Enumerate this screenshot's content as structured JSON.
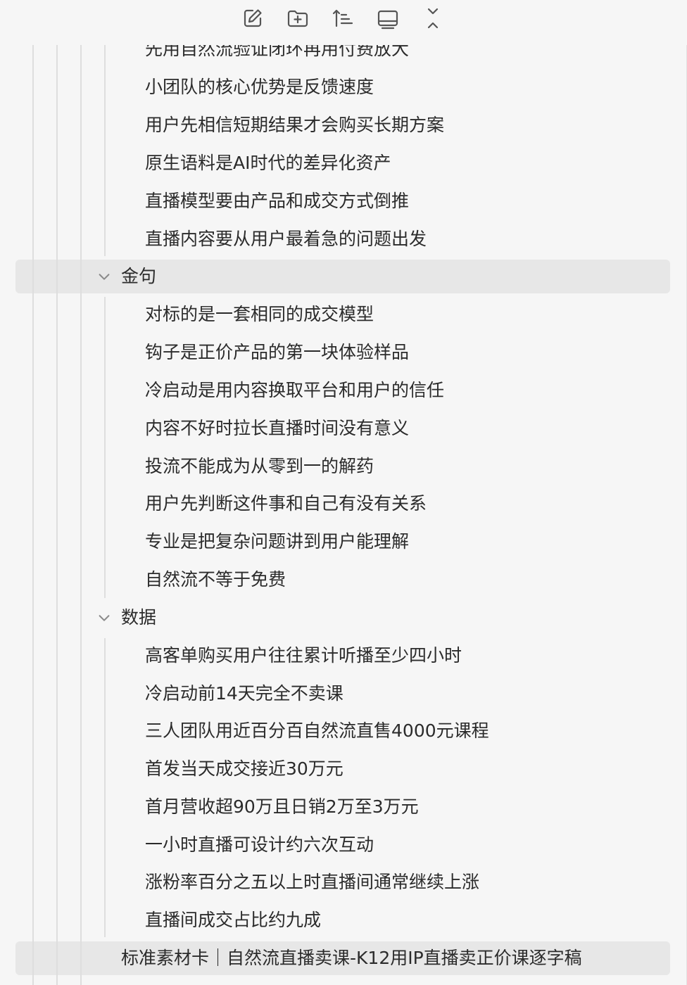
{
  "toolbar": {
    "buttons": [
      {
        "name": "new-note-button",
        "icon": "edit-icon"
      },
      {
        "name": "new-folder-button",
        "icon": "folder-plus-icon"
      },
      {
        "name": "sort-button",
        "icon": "sort-icon"
      },
      {
        "name": "collapse-panel-button",
        "icon": "panel-icon"
      },
      {
        "name": "collapse-all-button",
        "icon": "collapse-icon"
      }
    ]
  },
  "tree": {
    "partial_item": "先用自然流验证闭环再用付费放大",
    "top_items": [
      "小团队的核心优势是反馈速度",
      "用户先相信短期结果才会购买长期方案",
      "原生语料是AI时代的差异化资产",
      "直播模型要由产品和成交方式倒推",
      "直播内容要从用户最着急的问题出发"
    ],
    "folder_quotes": {
      "label": "金句",
      "items": [
        "对标的是一套相同的成交模型",
        "钩子是正价产品的第一块体验样品",
        "冷启动是用内容换取平台和用户的信任",
        "内容不好时拉长直播时间没有意义",
        "投流不能成为从零到一的解药",
        "用户先判断这件事和自己有没有关系",
        "专业是把复杂问题讲到用户能理解",
        "自然流不等于免费"
      ]
    },
    "folder_data": {
      "label": "数据",
      "items": [
        "高客单购买用户往往累计听播至少四小时",
        "冷启动前14天完全不卖课",
        "三人团队用近百分百自然流直售4000元课程",
        "首发当天成交接近30万元",
        "首月营收超90万且日销2万至3万元",
        "一小时直播可设计约六次互动",
        "涨粉率百分之五以上时直播间通常继续上涨",
        "直播间成交占比约九成"
      ]
    },
    "bottom_item": "标准素材卡｜自然流直播卖课-K12用IP直播卖正价课逐字稿"
  },
  "colors": {
    "background": "#f6f6f6",
    "highlight": "#e7e7e7",
    "guide": "#dedede",
    "icon": "#555555"
  }
}
